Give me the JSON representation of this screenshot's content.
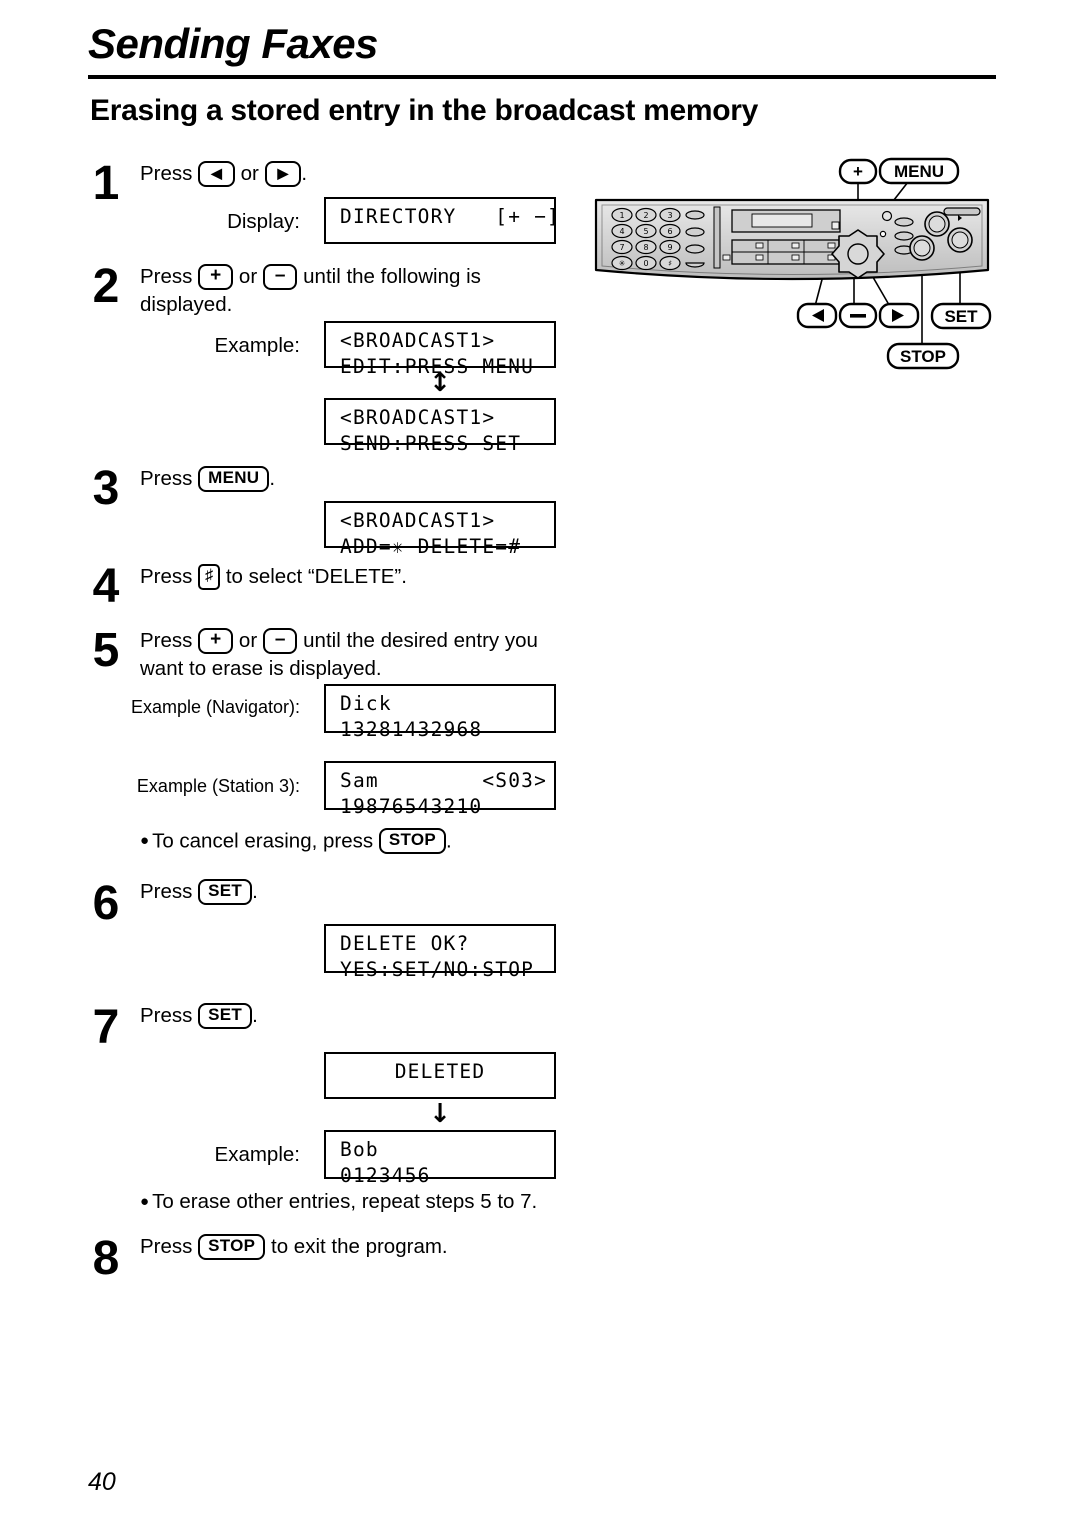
{
  "header": {
    "chapter": "Sending Faxes",
    "section": "Erasing a stored entry in the broadcast memory"
  },
  "steps": [
    {
      "number": "1",
      "text_before": "Press",
      "key_a": "◀",
      "or": "or",
      "key_b": "▶",
      "text_after": "."
    },
    {
      "number": "2",
      "line1_before": "Press",
      "key_a": "+",
      "or": "or",
      "key_b": "–",
      "line1_after": "until the following is",
      "line2": "displayed."
    },
    {
      "number": "3",
      "text_before": "Press",
      "key": "MENU",
      "text_after": "."
    },
    {
      "number": "4",
      "text_before": "Press",
      "key": "♯",
      "text_after": "to select “DELETE”."
    },
    {
      "number": "5",
      "line1_before": "Press",
      "key_a": "+",
      "or": "or",
      "key_b": "–",
      "line1_after": "until the desired entry you",
      "line2": "want to erase is displayed."
    },
    {
      "number": "6",
      "text_before": "Press",
      "key": "SET",
      "text_after": "."
    },
    {
      "number": "7",
      "text_before": "Press",
      "key": "SET",
      "text_after": "."
    },
    {
      "number": "8",
      "text_before": "Press",
      "key": "STOP",
      "text_after": "to exit the program."
    }
  ],
  "labels": {
    "display": "Display:",
    "example": "Example:",
    "example_navigator": "Example (Navigator):",
    "example_station3": "Example (Station 3):"
  },
  "lcd": {
    "directory": {
      "line1": "DIRECTORY   [+ −]",
      "line2": ""
    },
    "broadcast_edit": {
      "line1": "<BROADCAST1>",
      "line2": "EDIT:PRESS MENU"
    },
    "broadcast_send": {
      "line1": "<BROADCAST1>",
      "line2": "SEND:PRESS SET"
    },
    "broadcast_adddel": {
      "line1": "<BROADCAST1>",
      "line2": "ADD=✳ DELETE=#"
    },
    "entry_navigator": {
      "line1": "Dick",
      "line2": "13281432968"
    },
    "entry_station3": {
      "line1": "Sam        <S03>",
      "line2": "19876543210"
    },
    "delete_ok": {
      "line1": "DELETE OK?",
      "line2": "YES:SET/NO:STOP"
    },
    "deleted": {
      "line1": "DELETED",
      "line2": ""
    },
    "entry_bob": {
      "line1": "Bob",
      "line2": "0123456"
    }
  },
  "arrows": {
    "both_ways": "↕",
    "down": "↓"
  },
  "notes": {
    "cancel_before": "To cancel erasing, press",
    "cancel_key": "STOP",
    "cancel_after": ".",
    "repeat": "To erase other entries, repeat steps 5 to 7."
  },
  "diagram": {
    "callouts": {
      "plus": "+",
      "menu": "MENU",
      "left": "◀",
      "minus": "–",
      "right": "▶",
      "set": "SET",
      "stop": "STOP"
    },
    "keypad": [
      "1",
      "2",
      "3",
      "4",
      "5",
      "6",
      "7",
      "8",
      "9",
      "✳",
      "0",
      "♯"
    ]
  },
  "page_number": "40"
}
